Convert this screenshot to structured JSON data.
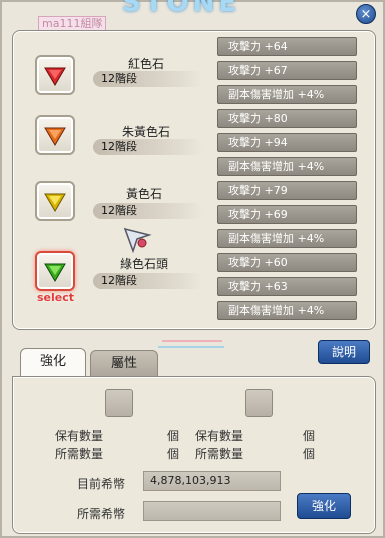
{
  "window": {
    "title": "STONE",
    "tag": "ma111組隊",
    "close_glyph": "×"
  },
  "gems": [
    {
      "name": "紅色石",
      "stage": "12階段",
      "color": "#d42a2a",
      "light": "#ff7070",
      "selected": false
    },
    {
      "name": "朱黃色石",
      "stage": "12階段",
      "color": "#e46a1a",
      "light": "#ffb070",
      "selected": false
    },
    {
      "name": "黃色石",
      "stage": "12階段",
      "color": "#d8b400",
      "light": "#fff070",
      "selected": false
    },
    {
      "name": "綠色石頭",
      "stage": "12階段",
      "color": "#3aaa1a",
      "light": "#9cf070",
      "selected": true
    }
  ],
  "select_label": "select",
  "stats": [
    "攻擊力 +64",
    "攻擊力 +67",
    "副本傷害增加 +4%",
    "攻擊力 +80",
    "攻擊力 +94",
    "副本傷害增加 +4%",
    "攻擊力 +79",
    "攻擊力 +69",
    "副本傷害增加 +4%",
    "攻擊力 +60",
    "攻擊力 +63",
    "副本傷害增加 +4%"
  ],
  "tabs": {
    "enhance": "強化",
    "attribute": "屬性"
  },
  "help_button": "說明",
  "enhance_panel": {
    "owned_label": "保有數量",
    "required_label": "所需數量",
    "unit": "個",
    "current_coin_label": "目前希幣",
    "current_coin_value": "4,878,103,913",
    "required_coin_label": "所需希幣",
    "required_coin_value": "",
    "enhance_button": "強化"
  },
  "colors": {
    "panel_bg": "#ece8dc",
    "stat_bg": "#9a958c",
    "button_blue": "#2f5fa8",
    "select_red": "#e23a3a"
  }
}
